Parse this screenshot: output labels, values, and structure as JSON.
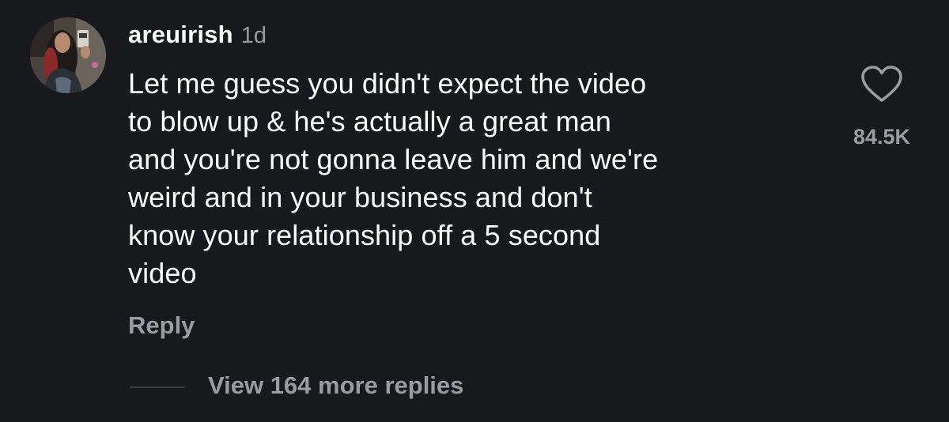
{
  "comment": {
    "username": "areuirish",
    "time": "1d",
    "text_lines": [
      "Let me guess you didn't expect the video",
      "to blow up & he's actually a great man",
      "and you're not gonna leave him and we're",
      "weird and in your business and don't",
      "know your relationship off a 5 second",
      "video"
    ],
    "like_icon": "heart-outline-icon",
    "like_count": "84.5K",
    "reply_label": "Reply",
    "view_replies_label": "View 164 more replies"
  },
  "colors": {
    "background": "#18191d",
    "primary_text": "#ffffff",
    "secondary_text": "#9a9ca4",
    "divider": "#3b3d43"
  }
}
